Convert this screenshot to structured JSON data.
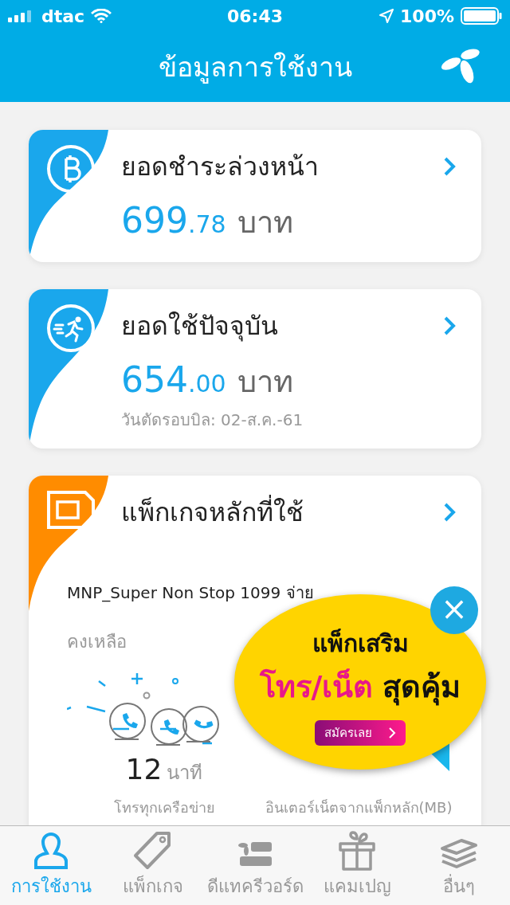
{
  "status_bar": {
    "carrier": "dtac",
    "time": "06:43",
    "battery": "100%"
  },
  "header": {
    "title": "ข้อมูลการใช้งาน"
  },
  "cards": [
    {
      "kind": "prepaid",
      "title": "ยอดชำระล่วงหน้า",
      "amount_main": "699",
      "amount_decimal": ".78",
      "unit": "บาท",
      "color": "#1aa7ec"
    },
    {
      "kind": "usage",
      "title": "ยอดใช้ปัจจุบัน",
      "amount_main": "654",
      "amount_decimal": ".00",
      "unit": "บาท",
      "note": "วันตัดรอบบิล: 02-ส.ค.-61",
      "color": "#1aa7ec"
    },
    {
      "kind": "package",
      "title": "แพ็กเกจหลักที่ใช้",
      "package_name": "MNP_Super Non Stop 1099 จ่าย",
      "remaining_label": "คงเหลือ",
      "color": "#ff8c00",
      "stats": [
        {
          "value": "12",
          "unit": "นาที",
          "label": "โทรทุกเครือข่าย"
        },
        {
          "label": "อินเตอร์เน็ตจากแพ็กหลัก(MB)"
        }
      ]
    }
  ],
  "promo": {
    "close": "×",
    "line1": "แพ็กเสริม",
    "highlight": "โทร/เน็ต",
    "line2_rest": "สุดคุ้ม",
    "button": "สมัครเลย"
  },
  "tabs": [
    {
      "label": "การใช้งาน",
      "selected": true
    },
    {
      "label": "แพ็กเกจ",
      "selected": false
    },
    {
      "label": "ดีแทครีวอร์ด",
      "selected": false
    },
    {
      "label": "แคมเปญ",
      "selected": false
    },
    {
      "label": "อื่นๆ",
      "selected": false
    }
  ]
}
